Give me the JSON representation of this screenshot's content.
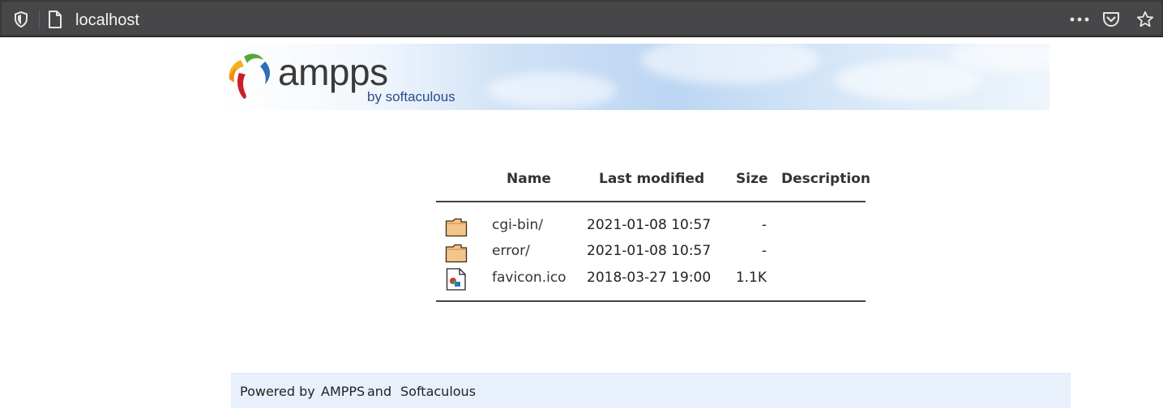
{
  "browser": {
    "url": "localhost",
    "icons": [
      "shield-icon",
      "page-icon",
      "more-icon",
      "pocket-icon",
      "star-icon"
    ]
  },
  "banner": {
    "logo_word": "ampps",
    "logo_by": "by softaculous"
  },
  "listing": {
    "columns": {
      "name": "Name",
      "last_modified": "Last modified",
      "size": "Size",
      "description": "Description"
    },
    "rows": [
      {
        "icon": "folder-icon",
        "name": "cgi-bin/",
        "modified": "2021-01-08 10:57",
        "size": "-",
        "description": ""
      },
      {
        "icon": "folder-icon",
        "name": "error/",
        "modified": "2021-01-08 10:57",
        "size": "-",
        "description": ""
      },
      {
        "icon": "image-file-icon",
        "name": "favicon.ico",
        "modified": "2018-03-27 19:00",
        "size": "1.1K",
        "description": ""
      }
    ]
  },
  "footer": {
    "prefix": "Powered by ",
    "link1": "AMPPS",
    "middle": " and ",
    "link2": "Softaculous"
  },
  "colors": {
    "toolbar": "#393939",
    "urlbar": "#474749",
    "footer_bg": "#e8f0fc",
    "folder": "#f4c58a"
  }
}
